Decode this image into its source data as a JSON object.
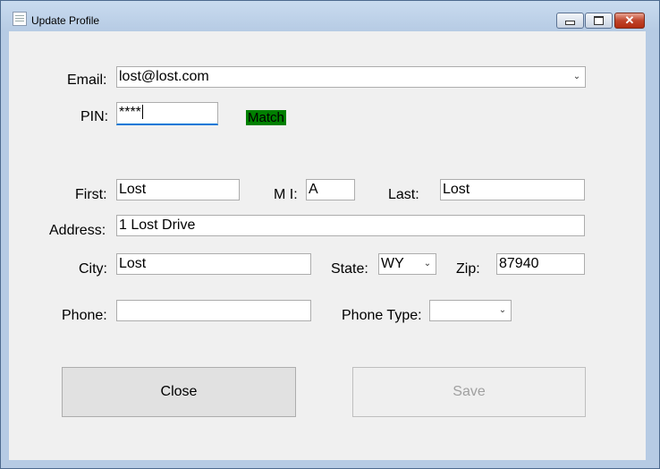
{
  "window": {
    "title": "Update Profile"
  },
  "form": {
    "email_label": "Email:",
    "email_value": "lost@lost.com",
    "pin_label": "PIN:",
    "pin_value": "****",
    "pin_status": "Match",
    "first_label": "First:",
    "first_value": "Lost",
    "mi_label": "M I:",
    "mi_value": "A",
    "last_label": "Last:",
    "last_value": "Lost",
    "address_label": "Address:",
    "address_value": "1 Lost Drive",
    "city_label": "City:",
    "city_value": "Lost",
    "state_label": "State:",
    "state_value": "WY",
    "zip_label": "Zip:",
    "zip_value": "87940",
    "phone_label": "Phone:",
    "phone_value": "",
    "phone_type_label": "Phone Type:",
    "phone_type_value": ""
  },
  "buttons": {
    "close": "Close",
    "save": "Save"
  },
  "colors": {
    "match_badge": "#008000",
    "focus_accent": "#0078d7"
  }
}
